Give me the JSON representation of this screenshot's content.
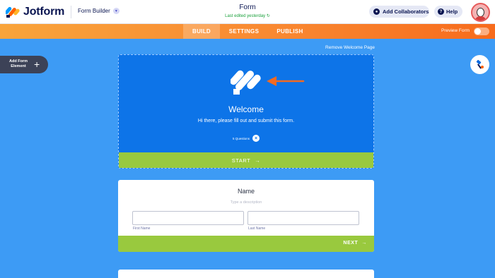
{
  "header": {
    "brand": "Jotform",
    "builder_label": "Form Builder",
    "form_title": "Form",
    "last_edited": "Last edited yesterday",
    "collab_label": "Add Collaborators",
    "help_label": "Help"
  },
  "nav": {
    "tabs": [
      "BUILD",
      "SETTINGS",
      "PUBLISH"
    ],
    "active_tab": "BUILD",
    "preview_label": "Preview Form",
    "preview_on": false
  },
  "sidebar": {
    "add_element_label": "Add Form Element"
  },
  "welcome": {
    "remove_link": "Remove Welcome Page",
    "title": "Welcome",
    "subtitle": "Hi there, please fill out and submit this form.",
    "questions": "5 Questions",
    "start_label": "START"
  },
  "name_field": {
    "title": "Name",
    "description_placeholder": "Type a description",
    "first_label": "First Name",
    "last_label": "Last Name",
    "next_label": "NEXT"
  },
  "colors": {
    "canvas": "#3d9bf5",
    "welcome_bg": "#0d74e8",
    "accent_green": "#99c93e",
    "nav_orange": "#f98932",
    "annotation_arrow": "#f26a21"
  }
}
